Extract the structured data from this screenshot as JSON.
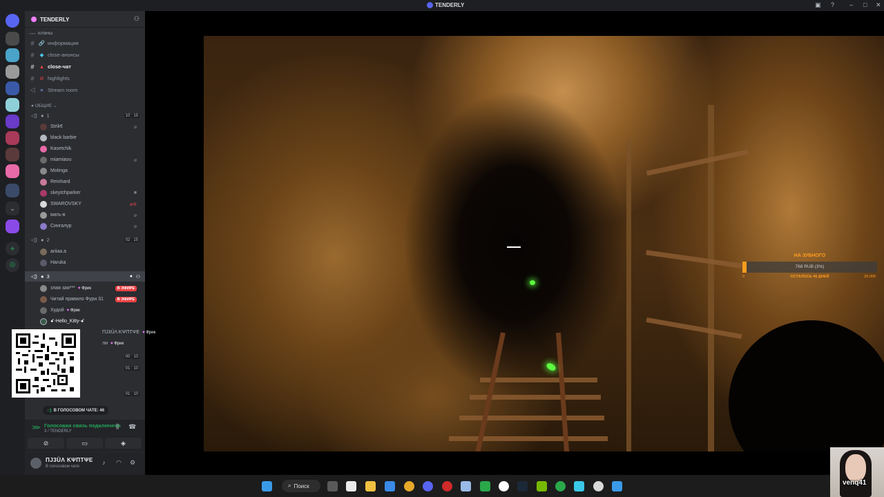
{
  "window": {
    "title": "TENDERLY"
  },
  "guild": {
    "name": "TENDERLY"
  },
  "channels": [
    {
      "name": "кланы",
      "kind": "category-link"
    },
    {
      "name": "информация",
      "kind": "text"
    },
    {
      "name": "close-анонсы",
      "kind": "text"
    },
    {
      "name": "close-чат",
      "kind": "text",
      "active": true
    },
    {
      "name": "highlights",
      "kind": "text"
    },
    {
      "name": "Stream room",
      "kind": "voice"
    }
  ],
  "category_general": "ОБЩИЕ",
  "voice1": {
    "name": "1",
    "count": "10",
    "limit": "15",
    "users": [
      "Strik€",
      "black barbie",
      "Kasetchik",
      "miamiaou",
      "Motinga",
      "Reinhard",
      "skeytchparker",
      "SWAROVSKY",
      "мать-в",
      "Сингалур"
    ]
  },
  "voice2": {
    "name": "2",
    "count": "02",
    "limit": "15",
    "users": [
      "ariiaa.a",
      "Haruka"
    ]
  },
  "voice3": {
    "name": "3",
    "users": [
      {
        "name": "злая зая***",
        "tag": "Фрик",
        "live": "В ЭФИРЕ"
      },
      {
        "name": "Читай правило Фури 31",
        "live": "В ЭФИРЕ"
      },
      {
        "name": "Худой",
        "tag": "Фрик"
      },
      {
        "name": "ꗃ-Hello_Kitty-ꗃ"
      },
      {
        "name": "ΠJ3ÜΛ KΨΠΤΨΕ",
        "tag": "Фрик"
      },
      {
        "name": "ли",
        "tag": "Фрик"
      }
    ]
  },
  "counts": [
    {
      "count": "00",
      "limit": "10"
    },
    {
      "count": "01",
      "limit": "10"
    },
    {
      "count": "01",
      "limit": "10"
    }
  ],
  "voice_pill": {
    "text": "В ГОЛОСОВОМ ЧАТЕ: 46"
  },
  "voice_panel": {
    "status": "Голосовая связь подключена",
    "sub": "3 / TENDERLY"
  },
  "user_panel": {
    "name": "ΠJ3ÜΛ KΨΠΤΨΕ",
    "status": "В голосовом чате"
  },
  "goal": {
    "title": "НА ЗУБНОГО",
    "bar_text": "768 RUB (3%)",
    "min": "0",
    "remaining": "ОСТАЛОСЬ 46 ДНЕЙ",
    "max": "25.000",
    "progress": 0.03
  },
  "webcam": {
    "nick": "venq41"
  },
  "taskbar": {
    "search_label": "Поиск"
  },
  "colors": {
    "accent": "#5865f2",
    "live": "#ed4245",
    "connected": "#23a55a",
    "goal": "#ff9d1f"
  }
}
